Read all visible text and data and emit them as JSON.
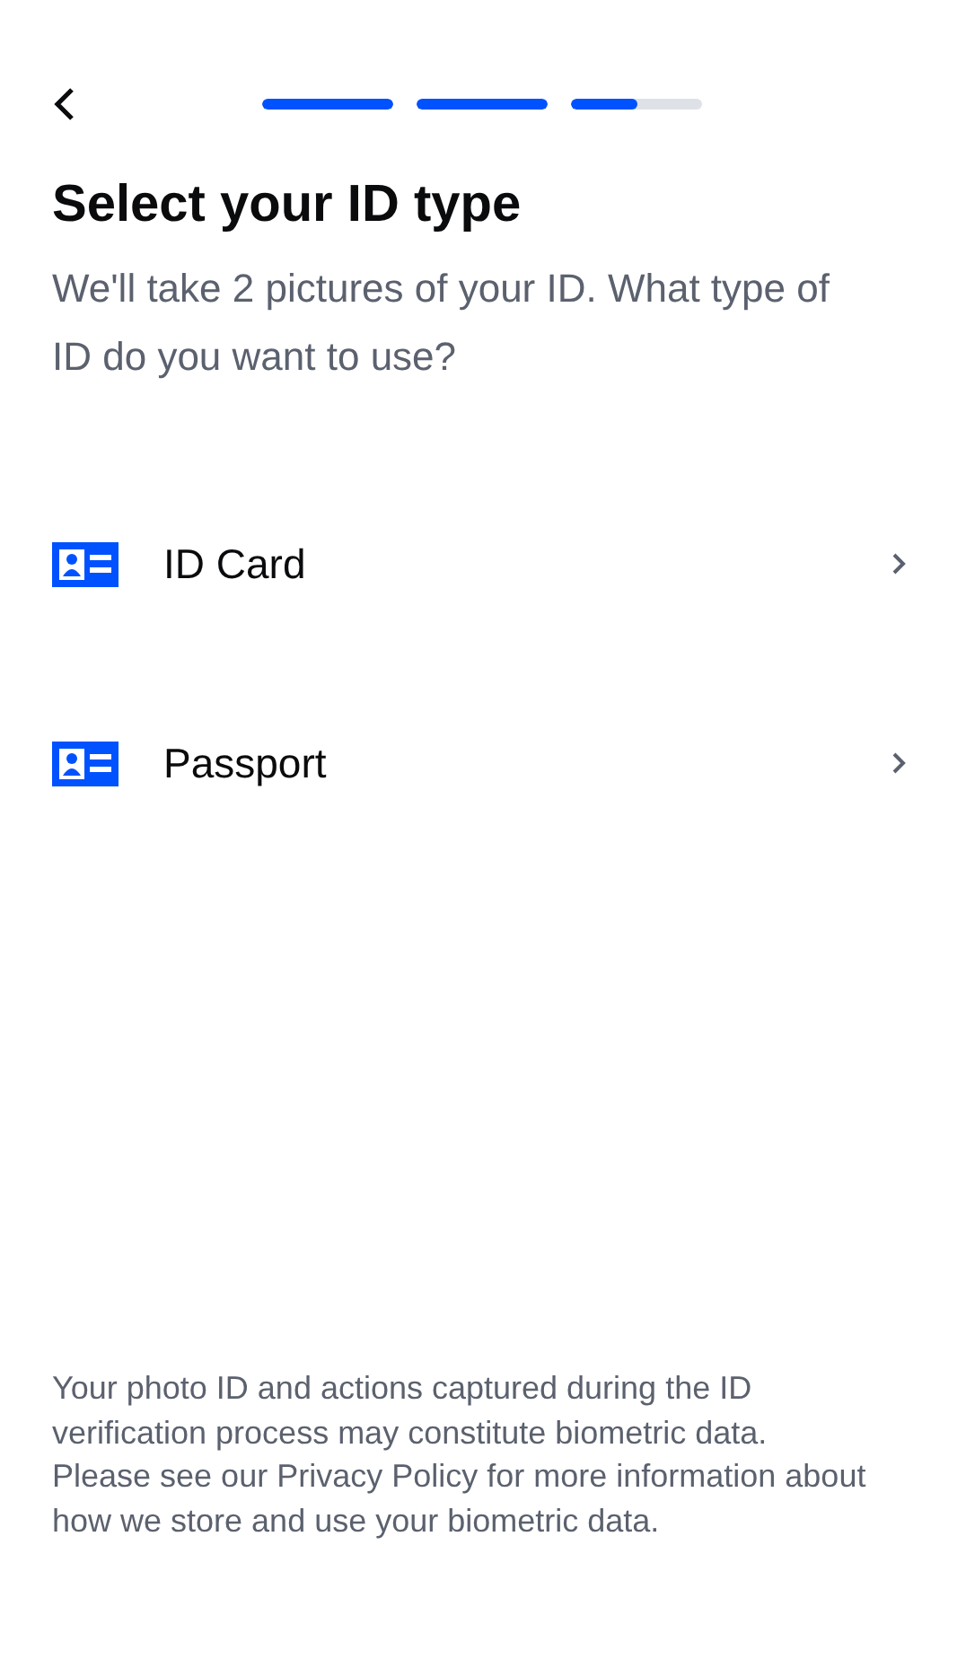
{
  "progress": [
    {
      "level": 1
    },
    {
      "level": 1
    },
    {
      "level": 0.5
    }
  ],
  "title": "Select your ID type",
  "subtitle": "We'll take 2 pictures of your ID. What type of ID do you want to use?",
  "options": [
    {
      "label": "ID Card"
    },
    {
      "label": "Passport"
    }
  ],
  "disclaimer": "Your photo ID and actions captured during the ID verification process may constitute biometric data. Please see our Privacy Policy for more information about how we store and use your biometric data."
}
